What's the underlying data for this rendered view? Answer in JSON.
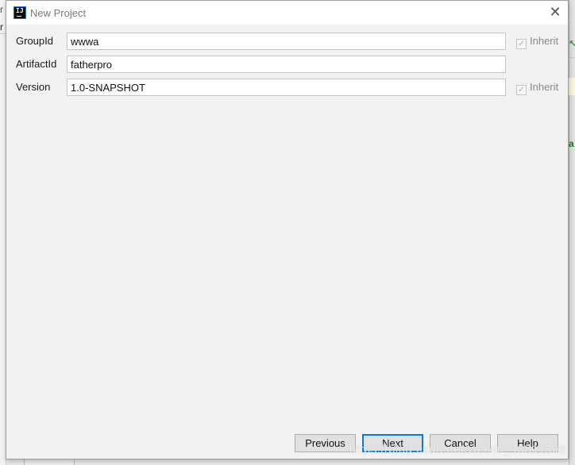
{
  "dialog": {
    "title": "New Project",
    "app_icon_text": "IJ",
    "close_glyph": "✕"
  },
  "form": {
    "fields": [
      {
        "label": "GroupId",
        "value": "wwwa",
        "inherit": {
          "label": "Inherit",
          "checked": true,
          "enabled": false
        }
      },
      {
        "label": "ArtifactId",
        "value": "fatherpro"
      },
      {
        "label": "Version",
        "value": "1.0-SNAPSHOT",
        "inherit": {
          "label": "Inherit",
          "checked": true,
          "enabled": false
        }
      }
    ]
  },
  "buttons": {
    "previous": "Previous",
    "next": "Next",
    "cancel": "Cancel",
    "help": "Help"
  },
  "checkmark_glyph": "✓",
  "background": {
    "left_char1": "r",
    "left_char2": "r",
    "right_char": "a",
    "right_arrow": "↖"
  },
  "watermark": "https://blog.csdn.net/weixin_43811598",
  "colors": {
    "primary_button_border": "#0a78d7",
    "dialog_bg": "#f2f2f2",
    "titlebar_bg": "#ffffff"
  }
}
